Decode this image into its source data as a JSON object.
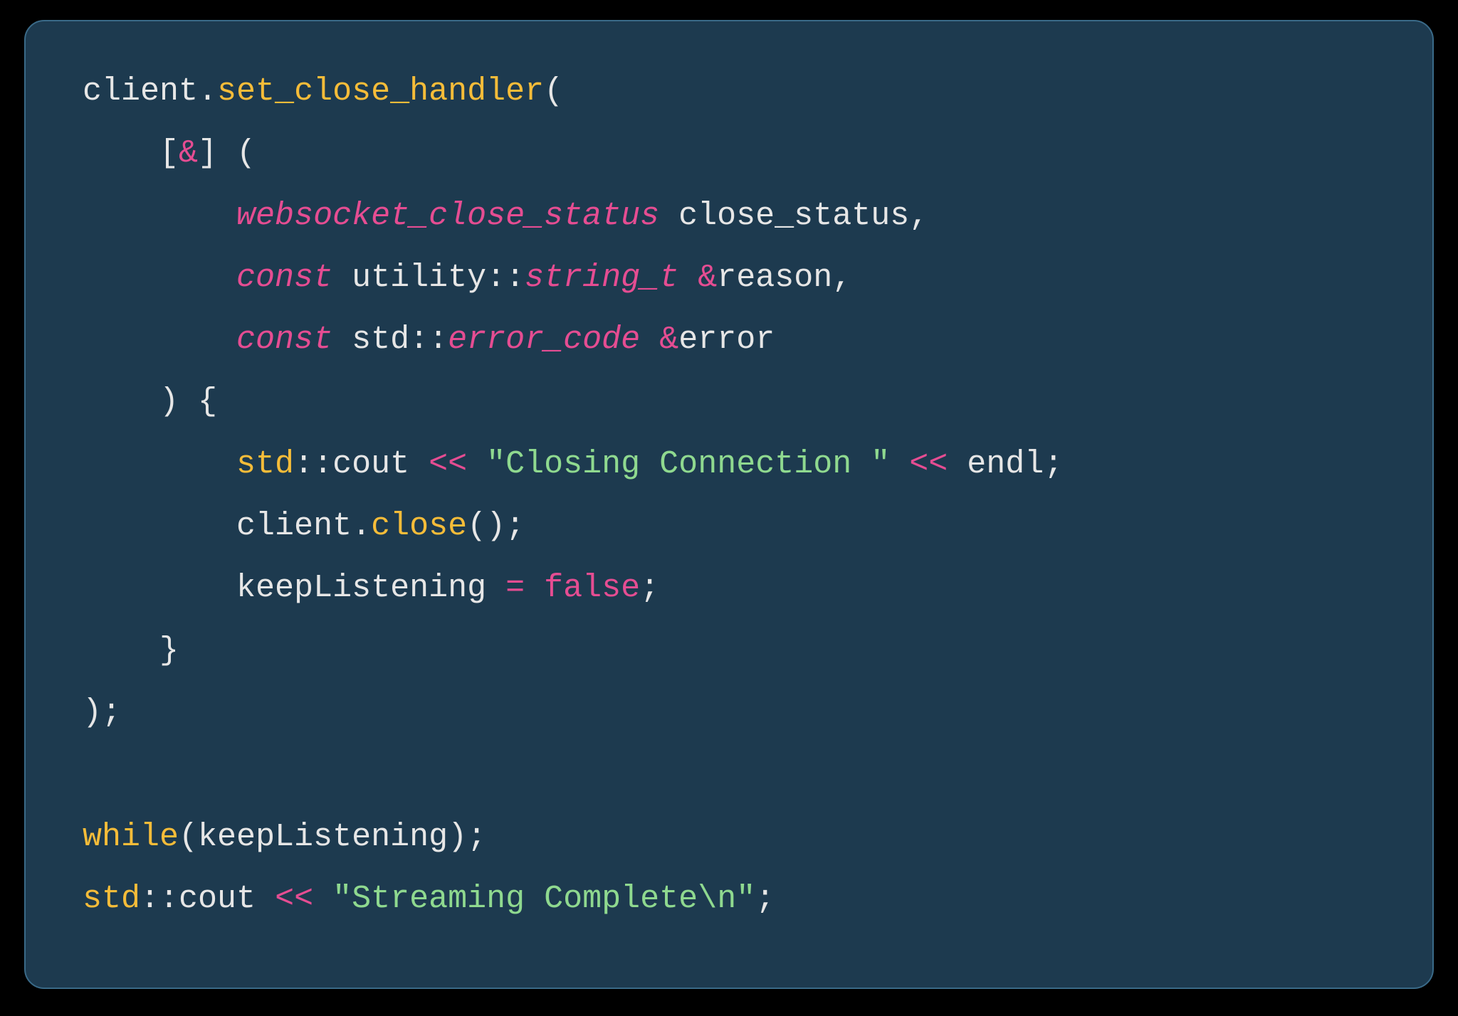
{
  "code": {
    "line1": {
      "t1": "client",
      "dot1": ".",
      "t2": "set_close_handler",
      "t3": "("
    },
    "line2": {
      "indent": "    ",
      "lb": "[",
      "amp": "&",
      "rb": "]",
      "sp": " ",
      "po": "("
    },
    "line3": {
      "indent": "        ",
      "type": "websocket_close_status",
      "rest": " close_status,"
    },
    "line4": {
      "indent": "        ",
      "kw": "const",
      "sp1": " ",
      "ns": "utility",
      "cc": "::",
      "type": "string_t",
      "sp2": " ",
      "amp": "&",
      "name": "reason",
      "comma": ","
    },
    "line5": {
      "indent": "        ",
      "kw": "const",
      "sp1": " ",
      "ns": "std",
      "cc": "::",
      "type": "error_code",
      "sp2": " ",
      "amp": "&",
      "name": "error"
    },
    "line6": {
      "indent": "    ",
      "t": ") {"
    },
    "line7": {
      "indent": "        ",
      "ns": "std",
      "cc": "::",
      "cout": "cout ",
      "op1": "<<",
      "sp1": " ",
      "str": "\"Closing Connection \"",
      "sp2": " ",
      "op2": "<<",
      "endl": " endl;"
    },
    "line8": {
      "indent": "        ",
      "obj": "client",
      "dot": ".",
      "fn": "close",
      "call": "();"
    },
    "line9": {
      "indent": "        ",
      "lhs": "keepListening ",
      "eq": "=",
      "sp": " ",
      "val": "false",
      "semi": ";"
    },
    "line10": {
      "indent": "    ",
      "t": "}"
    },
    "line11": {
      "t": ");"
    },
    "blank": "",
    "line13": {
      "kw": "while",
      "t": "(keepListening);"
    },
    "line14": {
      "ns": "std",
      "cc": "::",
      "cout": "cout ",
      "op": "<<",
      "sp": " ",
      "strOpen": "\"Streaming Complete",
      "esc": "\\n",
      "strClose": "\"",
      "semi": ";"
    }
  }
}
